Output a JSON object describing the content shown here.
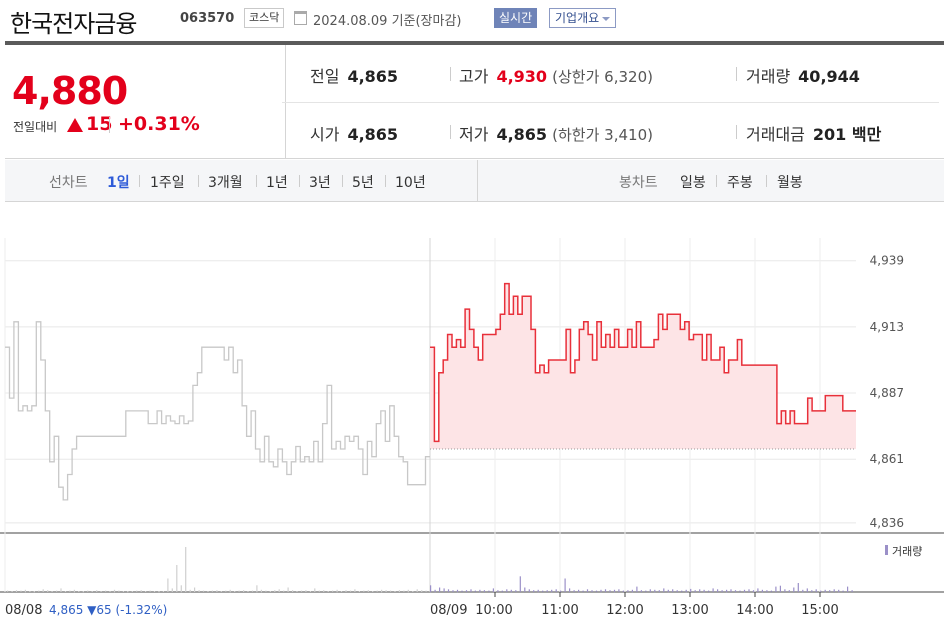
{
  "header": {
    "name": "한국전자금융",
    "code": "063570",
    "market": "코스닥",
    "date": "2024.08.09  기준(장마감)",
    "live_label": "실시간",
    "overview_label": "기업개요"
  },
  "price": {
    "current": "4,880",
    "change_label": "전일대비",
    "change": "15",
    "change_pct": "+0.31%"
  },
  "stats": {
    "prev_close": {
      "label": "전일",
      "value": "4,865"
    },
    "open": {
      "label": "시가",
      "value": "4,865"
    },
    "high": {
      "label": "고가",
      "value": "4,930",
      "sub": "(상한가 6,320)"
    },
    "low": {
      "label": "저가",
      "value": "4,865",
      "sub": "(하한가 3,410)"
    },
    "volume": {
      "label": "거래량",
      "value": "40,944"
    },
    "amount": {
      "label": "거래대금",
      "value": "201 백만"
    }
  },
  "tabs": {
    "line_label": "선차트",
    "periods": [
      "1일",
      "1주일",
      "3개월",
      "1년",
      "3년",
      "5년",
      "10년"
    ],
    "active_period": "1일",
    "candle_label": "봉차트",
    "candles": [
      "일봉",
      "주봉",
      "월봉"
    ]
  },
  "colors": {
    "up": "#e3001b",
    "prev_line": "#c8c8c8",
    "today_line": "#e8303a",
    "fill": "#fde4e6",
    "volume_today": "#9b90c8",
    "volume_prev": "#d0d0d0",
    "active_tab": "#2e5bd8"
  },
  "chart_data": {
    "type": "line",
    "ylim": [
      4832,
      4944
    ],
    "yticks": [
      4939,
      4913,
      4887,
      4861,
      4836
    ],
    "ytick_labels": [
      "4,939",
      "4,913",
      "4,887",
      "4,861",
      "4,836"
    ],
    "reference_line": 4865,
    "xtick_labels": [
      "08/08",
      "08/09",
      "10:00",
      "11:00",
      "12:00",
      "13:00",
      "14:00",
      "15:00"
    ],
    "prev_session_note": {
      "date": "08/08",
      "text": "4,865 ▼65 (-1.32%)"
    },
    "volume_legend": "거래량",
    "series": [
      {
        "session": "08/08",
        "values": [
          4905,
          4885,
          4915,
          4880,
          4882,
          4880,
          4882,
          4915,
          4900,
          4880,
          4860,
          4870,
          4850,
          4845,
          4855,
          4865,
          4870,
          4870,
          4870,
          4870,
          4870,
          4870,
          4870,
          4870,
          4870,
          4870,
          4870,
          4880,
          4880,
          4880,
          4880,
          4880,
          4875,
          4875,
          4880,
          4875,
          4878,
          4876,
          4875,
          4878,
          4875,
          4876,
          4890,
          4895,
          4905,
          4905,
          4905,
          4905,
          4905,
          4900,
          4905,
          4895,
          4900,
          4882,
          4870,
          4880,
          4865,
          4860,
          4870,
          4860,
          4858,
          4865,
          4860,
          4855,
          4860,
          4866,
          4860,
          4862,
          4860,
          4868,
          4860,
          4875,
          4890,
          4865,
          4868,
          4865,
          4870,
          4868,
          4870,
          4865,
          4855,
          4868,
          4862,
          4875,
          4880,
          4868,
          4882,
          4870,
          4862,
          4860,
          4851,
          4851,
          4851,
          4851,
          4862
        ]
      },
      {
        "session": "08/09",
        "values": [
          4905,
          4868,
          4895,
          4900,
          4910,
          4905,
          4908,
          4905,
          4920,
          4912,
          4905,
          4900,
          4910,
          4910,
          4910,
          4912,
          4918,
          4930,
          4918,
          4925,
          4918,
          4925,
          4925,
          4912,
          4895,
          4898,
          4895,
          4900,
          4900,
          4900,
          4900,
          4912,
          4895,
          4900,
          4912,
          4915,
          4910,
          4900,
          4915,
          4905,
          4910,
          4905,
          4912,
          4905,
          4905,
          4912,
          4905,
          4915,
          4905,
          4905,
          4905,
          4908,
          4918,
          4912,
          4918,
          4918,
          4918,
          4912,
          4915,
          4908,
          4910,
          4910,
          4900,
          4910,
          4900,
          4900,
          4905,
          4895,
          4900,
          4900,
          4908,
          4898,
          4898,
          4898,
          4898,
          4898,
          4898,
          4898,
          4898,
          4875,
          4880,
          4875,
          4880,
          4875,
          4875,
          4875,
          4885,
          4880,
          4880,
          4880,
          4886,
          4886,
          4886,
          4886,
          4880,
          4880,
          4880
        ]
      }
    ],
    "volume": {
      "max": 100,
      "prev": [
        3,
        2,
        4,
        3,
        5,
        2,
        1,
        3,
        6,
        4,
        2,
        3,
        8,
        2,
        3,
        5,
        2,
        1,
        3,
        2,
        4,
        2,
        3,
        2,
        5,
        3,
        2,
        1,
        2,
        3,
        4,
        2,
        3,
        2,
        1,
        2,
        30,
        8,
        60,
        15,
        100,
        5,
        10,
        4,
        3,
        2,
        3,
        4,
        2,
        3,
        5,
        2,
        3,
        4,
        2,
        3,
        15,
        5,
        3,
        2,
        4,
        6,
        3,
        10,
        4,
        2,
        3,
        4,
        2,
        8,
        3,
        4,
        2,
        3,
        5,
        2,
        4,
        3,
        6,
        2,
        3,
        4,
        2,
        3,
        5,
        4,
        3,
        2,
        4,
        3,
        5,
        2,
        6,
        4,
        3
      ],
      "today": [
        15,
        5,
        10,
        8,
        6,
        4,
        5,
        3,
        4,
        6,
        3,
        5,
        4,
        3,
        8,
        4,
        3,
        6,
        5,
        4,
        35,
        10,
        6,
        4,
        5,
        3,
        4,
        5,
        6,
        3,
        30,
        8,
        4,
        5,
        3,
        6,
        4,
        3,
        5,
        6,
        4,
        5,
        6,
        3,
        4,
        5,
        12,
        4,
        3,
        6,
        5,
        4,
        8,
        5,
        6,
        4,
        3,
        5,
        7,
        4,
        6,
        5,
        3,
        8,
        6,
        4,
        5,
        6,
        4,
        3,
        5,
        6,
        4,
        8,
        5,
        4,
        3,
        12,
        14,
        6,
        4,
        10,
        20,
        5,
        8,
        4,
        6,
        3,
        5,
        4,
        6,
        5,
        3,
        12,
        4
      ]
    }
  }
}
